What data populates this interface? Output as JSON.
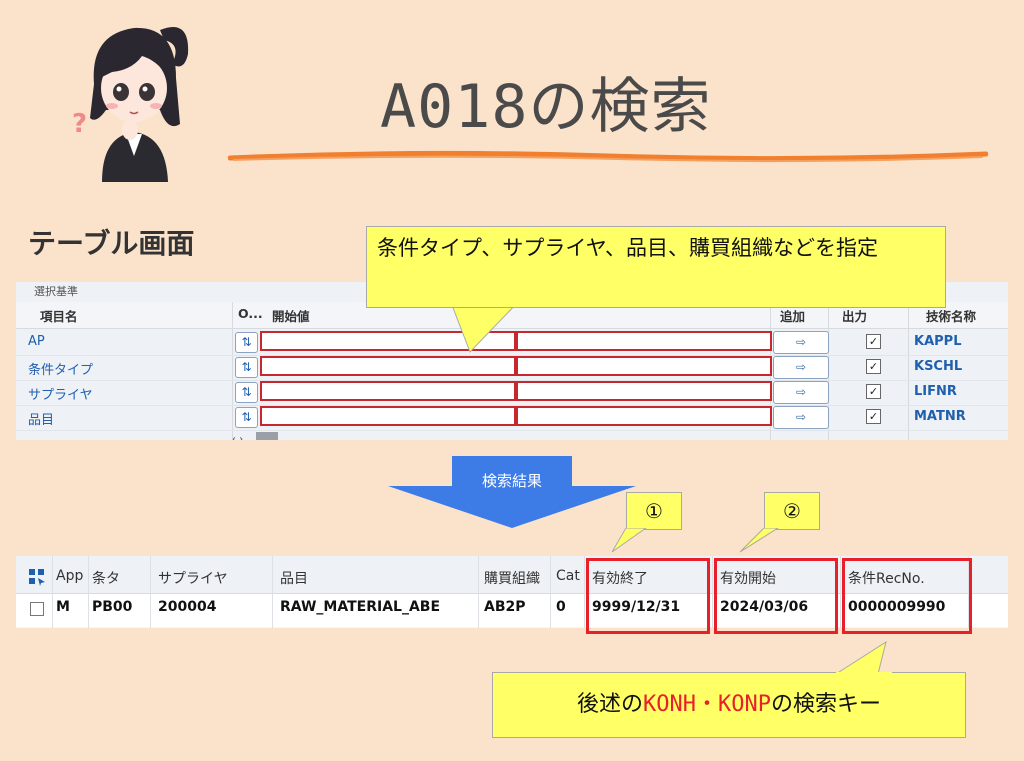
{
  "title": "A018の検索",
  "section_title": "テーブル画面",
  "selection_table": {
    "panel_label": "選択基準",
    "headers": {
      "field_name": "項目名",
      "option": "O...",
      "start_value": "開始値",
      "add": "追加",
      "output": "出力",
      "tech_name": "技術名称"
    },
    "rows": [
      {
        "label": "AP",
        "tech": "KAPPL",
        "checked": true
      },
      {
        "label": "条件タイプ",
        "tech": "KSCHL",
        "checked": true
      },
      {
        "label": "サプライヤ",
        "tech": "LIFNR",
        "checked": true
      },
      {
        "label": "品目",
        "tech": "MATNR",
        "checked": true
      }
    ],
    "scroll_indicator": "‹ ›"
  },
  "callout_top": "条件タイプ、サプライヤ、品目、購買組織などを指定",
  "arrow_label": "検索結果",
  "bubble_1": "①",
  "bubble_2": "②",
  "result_table": {
    "headers": [
      "App",
      "条タ",
      "サプライヤ",
      "品目",
      "購買組織",
      "Cat",
      "有効終了",
      "有効開始",
      "条件RecNo."
    ],
    "row": [
      "M",
      "PB00",
      "200004",
      "RAW_MATERIAL_ABE",
      "AB2P",
      "0",
      "9999/12/31",
      "2024/03/06",
      "0000009990"
    ]
  },
  "callout_bottom": {
    "prefix": "後述の",
    "highlight": "KONH・KONP",
    "suffix": "の検索キー"
  },
  "colors": {
    "background": "#fbe3cb",
    "callout": "#ffff66",
    "red_frame": "#e8202a",
    "arrow": "#3d7be6",
    "link_blue": "#1f5fae"
  },
  "icons": {
    "option_button": "selection-option-icon",
    "add_button": "multiple-selection-icon",
    "grid_settings": "grid-settings-icon"
  }
}
